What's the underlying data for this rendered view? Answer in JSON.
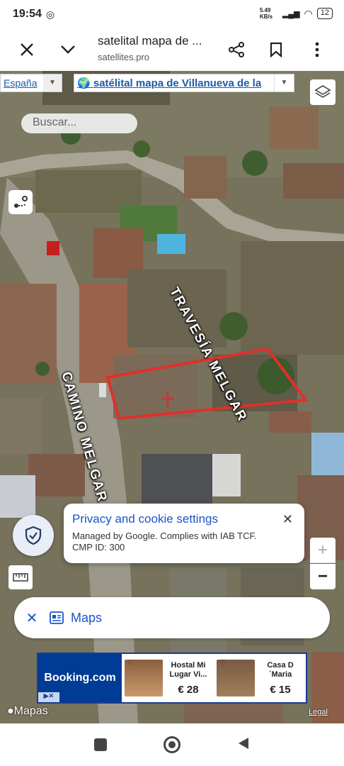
{
  "status_bar": {
    "time": "19:54",
    "network_speed": "5.49 KB/s",
    "battery": "12"
  },
  "toolbar": {
    "title": "satelital mapa de ...",
    "url": "satellites.pro"
  },
  "map": {
    "region_select": "España",
    "site_select": "satélital mapa de Villanueva de la",
    "search_placeholder": "Buscar...",
    "street_1": "TRAVESÍA MELGAR",
    "street_2": "CAMINO MELGAR",
    "zoom_in": "+",
    "zoom_out": "−"
  },
  "privacy": {
    "title": "Privacy and cookie settings",
    "body": "Managed by Google. Complies with IAB TCF. CMP ID: 300"
  },
  "maps_bar": {
    "label": "Maps"
  },
  "ad": {
    "brand": "Booking.com",
    "items": [
      {
        "name": "Hostal Mi Lugar Vi...",
        "price": "€ 28"
      },
      {
        "name": "Casa D ´Maria",
        "price": "€ 15"
      }
    ]
  },
  "attribution": {
    "apple": "Mapas",
    "legal": "Legal"
  },
  "colors": {
    "accent": "#1a55c8",
    "plot_outline": "#e0302a",
    "booking": "#003b95"
  }
}
